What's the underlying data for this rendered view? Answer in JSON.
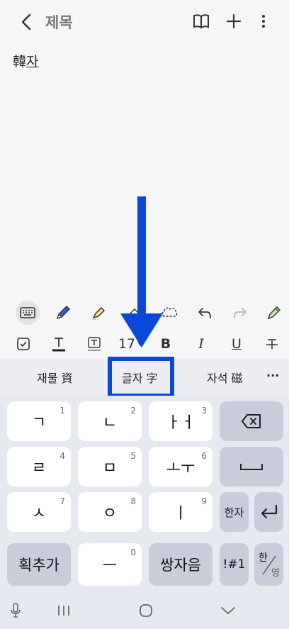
{
  "header": {
    "title": "제목",
    "icons": [
      "back-icon",
      "book-icon",
      "plus-icon",
      "more-icon"
    ]
  },
  "note": {
    "text_plain": "韓",
    "text_underlined": "자"
  },
  "tools": [
    "keyboard-icon",
    "pen-icon",
    "highlighter-icon",
    "eraser-icon",
    "lasso-icon",
    "undo-icon",
    "redo-icon",
    "pen-settings-icon"
  ],
  "format": {
    "font_size": "17",
    "items": [
      "checkbox-icon",
      "text-color-icon",
      "text-box-icon",
      "bold-icon",
      "italic-icon",
      "underline-icon",
      "strikethrough-icon"
    ],
    "bold": "B",
    "italic": "I",
    "underline": "U"
  },
  "suggestions": {
    "items": [
      "재물 資",
      "글자 字",
      "자석 磁"
    ],
    "more": "···",
    "highlight_color": "#0a49d8"
  },
  "keyboard": {
    "rows": [
      [
        {
          "label": "ㄱ",
          "num": "1"
        },
        {
          "label": "ㄴ",
          "num": "2"
        },
        {
          "label": "ㅏㅓ",
          "num": "3"
        }
      ],
      [
        {
          "label": "ㄹ",
          "num": "4"
        },
        {
          "label": "ㅁ",
          "num": "5"
        },
        {
          "label": "ㅗㅜ",
          "num": "6"
        }
      ],
      [
        {
          "label": "ㅅ",
          "num": "7"
        },
        {
          "label": "ㅇ",
          "num": "8"
        },
        {
          "label": "ㅣ",
          "num": "9"
        }
      ],
      [
        {
          "label": "ㅡ",
          "num": "0"
        }
      ]
    ],
    "stroke_add": "획추가",
    "double_consonant": "쌍자음",
    "hanja": "한자",
    "symbols": "!#1",
    "lang_top": "한",
    "lang_bottom": "영"
  }
}
